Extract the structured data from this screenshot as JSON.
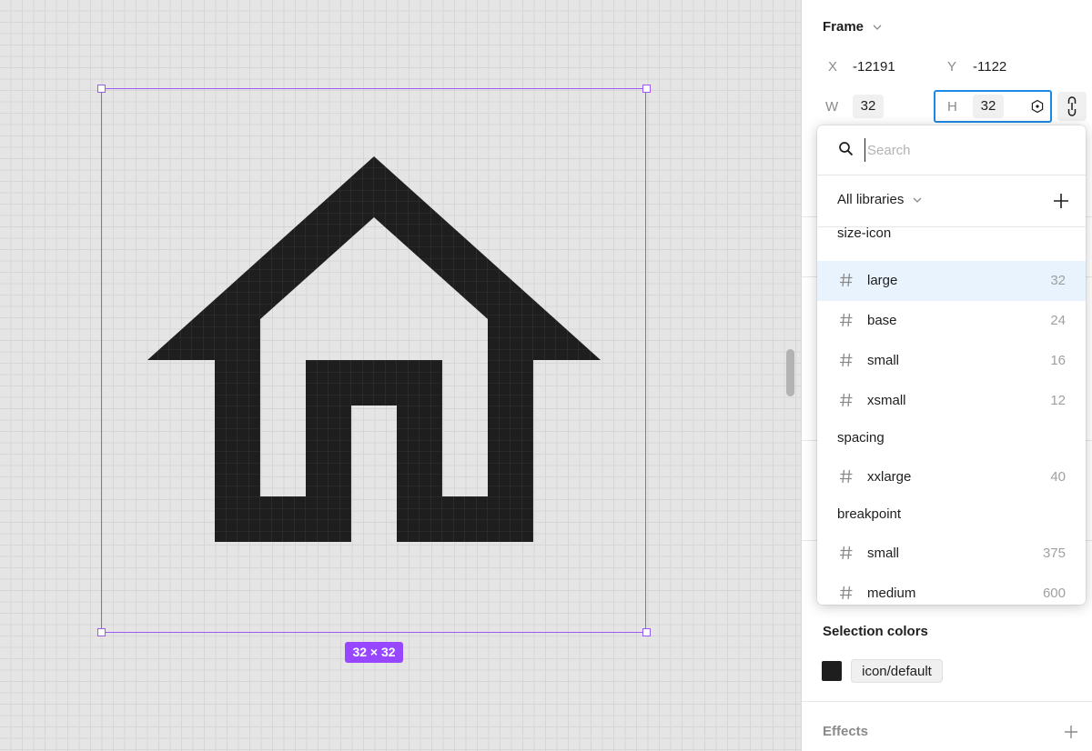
{
  "canvas": {
    "size_badge": "32 × 32",
    "colors": {
      "selection": "#9b59f5",
      "badge": "#9747ff",
      "icon_fill": "#1e1e1e"
    }
  },
  "frame_panel": {
    "title": "Frame",
    "x_label": "X",
    "x_value": "-12191",
    "y_label": "Y",
    "y_value": "-1122",
    "w_label": "W",
    "w_value": "32",
    "h_label": "H",
    "h_value": "32"
  },
  "dropdown": {
    "search_placeholder": "Search",
    "library_label": "All libraries",
    "groups": [
      {
        "name": "size-icon",
        "items": [
          {
            "name": "large",
            "value": "32",
            "selected": true
          },
          {
            "name": "base",
            "value": "24"
          },
          {
            "name": "small",
            "value": "16"
          },
          {
            "name": "xsmall",
            "value": "12"
          }
        ]
      },
      {
        "name": "spacing",
        "items": [
          {
            "name": "xxlarge",
            "value": "40"
          }
        ]
      },
      {
        "name": "breakpoint",
        "items": [
          {
            "name": "small",
            "value": "375"
          },
          {
            "name": "medium",
            "value": "600"
          }
        ]
      }
    ]
  },
  "selection_colors": {
    "title": "Selection colors",
    "swatch_color": "#1e1e1e",
    "style_name": "icon/default"
  },
  "effects": {
    "title": "Effects"
  }
}
